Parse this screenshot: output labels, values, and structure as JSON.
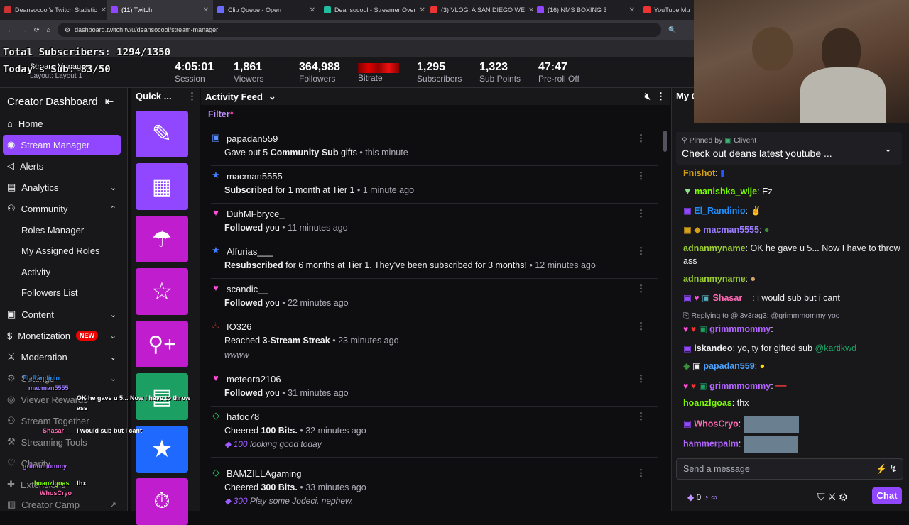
{
  "browser": {
    "tabs": [
      {
        "label": "Deansocool's Twitch Statistic",
        "color": "#c33"
      },
      {
        "label": "(11) Twitch",
        "color": "#9147ff"
      },
      {
        "label": "Clip Queue - Open",
        "color": "#6b6bff"
      },
      {
        "label": "Deansocool - Streamer Over",
        "color": "#1dbf9f"
      },
      {
        "label": "(3) VLOG: A SAN DIEGO WE",
        "color": "#e33"
      },
      {
        "label": "(16) NMS BOXING 3",
        "color": "#9147ff"
      },
      {
        "label": "YouTube Mu",
        "color": "#e33"
      }
    ],
    "url": "dashboard.twitch.tv/u/deansocool/stream-manager"
  },
  "overlay": {
    "total_subs": "Total Subscribers: 1294/1350",
    "today_subs": "Today's Sub: 83/50"
  },
  "header": {
    "title": "Stream Manager",
    "layout": "Layout: Layout 1",
    "stats": [
      {
        "value": "4:05:01",
        "label": "Session"
      },
      {
        "value": "1,861",
        "label": "Viewers"
      },
      {
        "value": "364,988",
        "label": "Followers"
      },
      {
        "value": "",
        "label": "Bitrate"
      },
      {
        "value": "1,295",
        "label": "Subscribers"
      },
      {
        "value": "1,323",
        "label": "Sub Points"
      },
      {
        "value": "47:47",
        "label": "Pre-roll Off"
      }
    ]
  },
  "sidebar": {
    "title": "Creator Dashboard",
    "items": [
      {
        "label": "Home"
      },
      {
        "label": "Stream Manager"
      },
      {
        "label": "Alerts"
      },
      {
        "label": "Analytics"
      },
      {
        "label": "Community"
      },
      {
        "label": "Roles Manager"
      },
      {
        "label": "My Assigned Roles"
      },
      {
        "label": "Activity"
      },
      {
        "label": "Followers List"
      },
      {
        "label": "Content"
      },
      {
        "label": "Monetization",
        "badge": "NEW"
      },
      {
        "label": "Moderation"
      },
      {
        "label": "Settings"
      },
      {
        "label": "Viewer Rewards"
      },
      {
        "label": "Stream Together"
      },
      {
        "label": "Streaming Tools"
      },
      {
        "label": "Charity"
      },
      {
        "label": "Extensions"
      },
      {
        "label": "Creator Camp"
      }
    ]
  },
  "quick_actions": {
    "title": "Quick ..."
  },
  "feed": {
    "title": "Activity Feed",
    "filter": "Filter",
    "items": [
      {
        "name": "papadan559",
        "pre": "Gave out 5 ",
        "bold": "Community Sub",
        "post": " gifts",
        "time": "this minute",
        "msg": ""
      },
      {
        "name": "macman5555",
        "pre": "",
        "bold": "Subscribed",
        "post": " for 1 month at Tier 1",
        "time": "1 minute ago",
        "msg": ""
      },
      {
        "name": "DuhMFbryce_",
        "pre": "",
        "bold": "Followed",
        "post": " you",
        "time": "11 minutes ago",
        "msg": ""
      },
      {
        "name": "Alfurias___",
        "pre": "",
        "bold": "Resubscribed",
        "post": " for 6 months at Tier 1. They've been subscribed for 3 months!",
        "time": "12 minutes ago",
        "msg": ""
      },
      {
        "name": "scandic__",
        "pre": "",
        "bold": "Followed",
        "post": " you",
        "time": "22 minutes ago",
        "msg": ""
      },
      {
        "name": "IO326",
        "pre": "Reached ",
        "bold": "3-Stream Streak",
        "post": "",
        "time": "23 minutes ago",
        "msg": "wwww"
      },
      {
        "name": "meteora2106",
        "pre": "",
        "bold": "Followed",
        "post": " you",
        "time": "31 minutes ago",
        "msg": ""
      },
      {
        "name": "hafoc78",
        "pre": "Cheered ",
        "bold": "100 Bits.",
        "post": "",
        "time": "32 minutes ago",
        "bits": "100",
        "msg": "looking good today"
      },
      {
        "name": "BAMZILLAgaming",
        "pre": "Cheered ",
        "bold": "300 Bits.",
        "post": "",
        "time": "33 minutes ago",
        "bits": "300",
        "msg": "Play some Jodeci, nephew."
      }
    ]
  },
  "chat": {
    "title": "My C",
    "pinned_by": "Pinned by",
    "pinned_user": "Clivent",
    "pinned_text": "Check out deans latest youtube ...",
    "messages": [
      {
        "user": "Fnishot",
        "color": "#d4a017",
        "text": ""
      },
      {
        "user": "manishka_wije",
        "color": "#7cfc00",
        "text": " Ez"
      },
      {
        "user": "El_Randinio",
        "color": "#1e90ff",
        "text": ""
      },
      {
        "user": "macman5555",
        "color": "#9b7bff",
        "text": ""
      },
      {
        "user": "adnanmyname",
        "color": "#9acd32",
        "text": " OK he gave u 5... Now I have to throw"
      },
      {
        "user": "",
        "color": "#efeff1",
        "text": "ass"
      },
      {
        "user": "adnanmyname",
        "color": "#9acd32",
        "text": ""
      },
      {
        "user": "Shasar__",
        "color": "#ff69b4",
        "text": " i would sub but i cant"
      },
      {
        "user": "Replying to @l3v3rag3: @grimmmommy yoo",
        "color": "#adadb8",
        "text": ""
      },
      {
        "user": "grimmmommy",
        "color": "#b266ff",
        "text": ""
      },
      {
        "user": "iskandeo",
        "color": "#efeff1",
        "text": " yo, ty for gifted sub ",
        "mention": "@kartikwd"
      },
      {
        "user": "papadan559",
        "color": "#4da3ff",
        "text": ""
      },
      {
        "user": "grimmmommy",
        "color": "#b266ff",
        "text": ""
      },
      {
        "user": "hoanzlgoas",
        "color": "#7cfc00",
        "text": " thx"
      },
      {
        "user": "WhosCryo",
        "color": "#ff69b4",
        "text": ""
      },
      {
        "user": "hammerpalm",
        "color": "#b266ff",
        "text": ""
      }
    ],
    "send_placeholder": "Send a message",
    "points": "0",
    "chat_button": "Chat"
  },
  "colors": {
    "accent": "#9147ff",
    "magenta": "#bf1dce",
    "green": "#1b9f63",
    "blue": "#1f69ff"
  }
}
